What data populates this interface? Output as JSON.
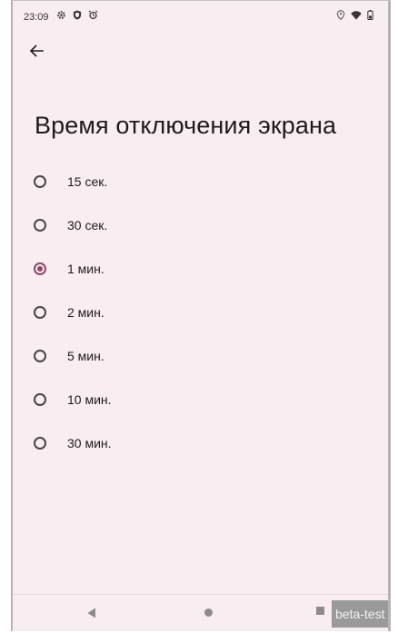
{
  "status_bar": {
    "time": "23:09",
    "left_icons": [
      "gear-icon",
      "shield-icon",
      "alarm-icon"
    ],
    "right_icons": [
      "location-icon",
      "wifi-icon",
      "battery-icon"
    ]
  },
  "header": {
    "back_icon": "arrow-left-icon"
  },
  "page": {
    "title": "Время отключения экрана"
  },
  "options": [
    {
      "label": "15 сек.",
      "selected": false
    },
    {
      "label": "30 сек.",
      "selected": false
    },
    {
      "label": "1 мин.",
      "selected": true
    },
    {
      "label": "2 мин.",
      "selected": false
    },
    {
      "label": "5 мин.",
      "selected": false
    },
    {
      "label": "10 мин.",
      "selected": false
    },
    {
      "label": "30 мин.",
      "selected": false
    }
  ],
  "nav_bar": {
    "icons": [
      "nav-back-icon",
      "nav-home-icon",
      "nav-recents-icon"
    ]
  },
  "watermark": {
    "text": "beta-test"
  },
  "colors": {
    "background": "#f8edf0",
    "accent": "#8b4a6b",
    "text": "#201a1c"
  }
}
